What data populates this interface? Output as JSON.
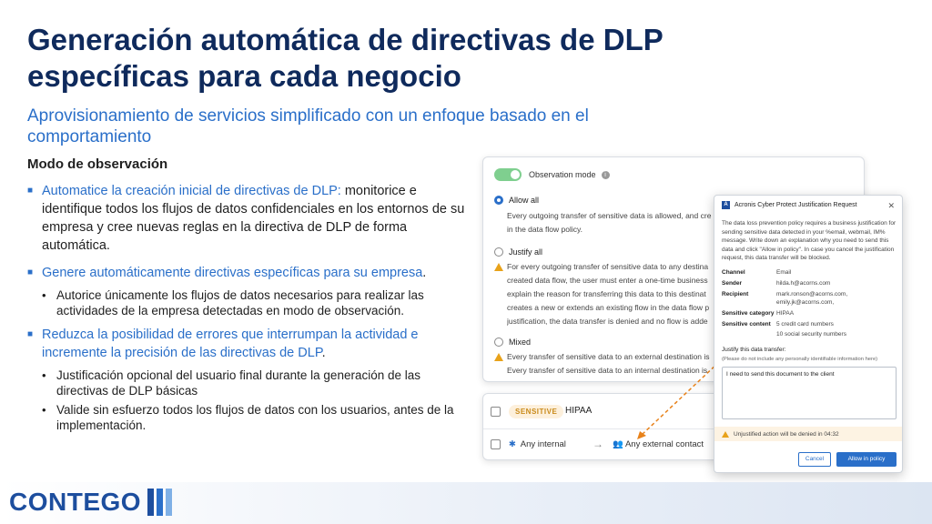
{
  "slide": {
    "title": "Generación automática de directivas de DLP específicas para cada negocio",
    "subtitle": "Aprovisionamiento de servicios simplificado con un enfoque basado en el comportamiento",
    "section_heading": "Modo de observación",
    "bullet1": {
      "lead": "Automatice la creación inicial de directivas de DLP:",
      "rest": " monitorice e identifique todos los flujos de datos confidenciales en los entornos de su empresa y cree nuevas reglas en la directiva de DLP de forma automática."
    },
    "bullet2": {
      "lead": "Genere automáticamente directivas específicas para su empresa",
      "rest": ".",
      "sub": [
        "Autorice únicamente los flujos de datos necesarios para realizar las actividades de la empresa detectadas en modo de observación."
      ]
    },
    "bullet3": {
      "lead": "Reduzca la posibilidad de errores que interrumpan la actividad e incremente la precisión de las directivas de DLP",
      "rest": ".",
      "sub": [
        "Justificación opcional del usuario final durante la generación de las directivas de DLP básicas",
        "Valide sin esfuerzo todos los flujos de datos con los usuarios, antes de la implementación."
      ]
    }
  },
  "panel": {
    "toggle_label": "Observation mode",
    "options": [
      {
        "label": "Allow all",
        "desc": [
          "Every outgoing transfer of sensitive data is allowed, and cre",
          "in the data flow policy."
        ]
      },
      {
        "label": "Justify all",
        "desc": [
          "For every outgoing transfer of sensitive data to any destina",
          "created data flow, the user must enter a one-time business",
          "explain the reason for transferring this data to this destinat",
          "creates a new or extends an existing flow in the data flow p",
          "justification, the data transfer is denied and no flow is adde"
        ]
      },
      {
        "label": "Mixed",
        "desc": [
          "Every transfer of sensitive data to an external destination is",
          "Every transfer of sensitive data to an internal destination is"
        ]
      }
    ]
  },
  "rule_card": {
    "badge": "SENSITIVE",
    "category": "HIPAA",
    "from": "Any internal",
    "to": "Any external contact"
  },
  "dialog": {
    "title": "Acronis Cyber Protect Justification Request",
    "intro": "The data loss prevention policy requires a business justification for sending sensitive data detected in your %email, webmail, IM% message. Write down an explanation why you need to send this data and click \"Allow in policy\". In case you cancel the justification request, this data transfer will be blocked.",
    "fields": [
      {
        "k": "Channel",
        "v": "Email"
      },
      {
        "k": "Sender",
        "v": "hilda.h@acorns.com"
      },
      {
        "k": "Recipient",
        "v": "mark.ronson@acorns.com, emily.jk@acorns.com,"
      },
      {
        "k": "Sensitive category",
        "v": "HIPAA"
      },
      {
        "k": "Sensitive content",
        "v": "5 credit card numbers"
      },
      {
        "k": "",
        "v": "10 social security numbers"
      }
    ],
    "justify_label": "Justify this data transfer:",
    "justify_hint": "(Please do not include any personally identifiable information here)",
    "justify_text": "I need to send this document to the client",
    "warning": "Unjustified action will be denied in 04:32",
    "cancel": "Cancel",
    "allow": "Allow in policy"
  },
  "footer": {
    "logo": "CONTEGO",
    "bar_colors": [
      "#1d4e9e",
      "#2a6fc9",
      "#7fb0e6"
    ]
  }
}
